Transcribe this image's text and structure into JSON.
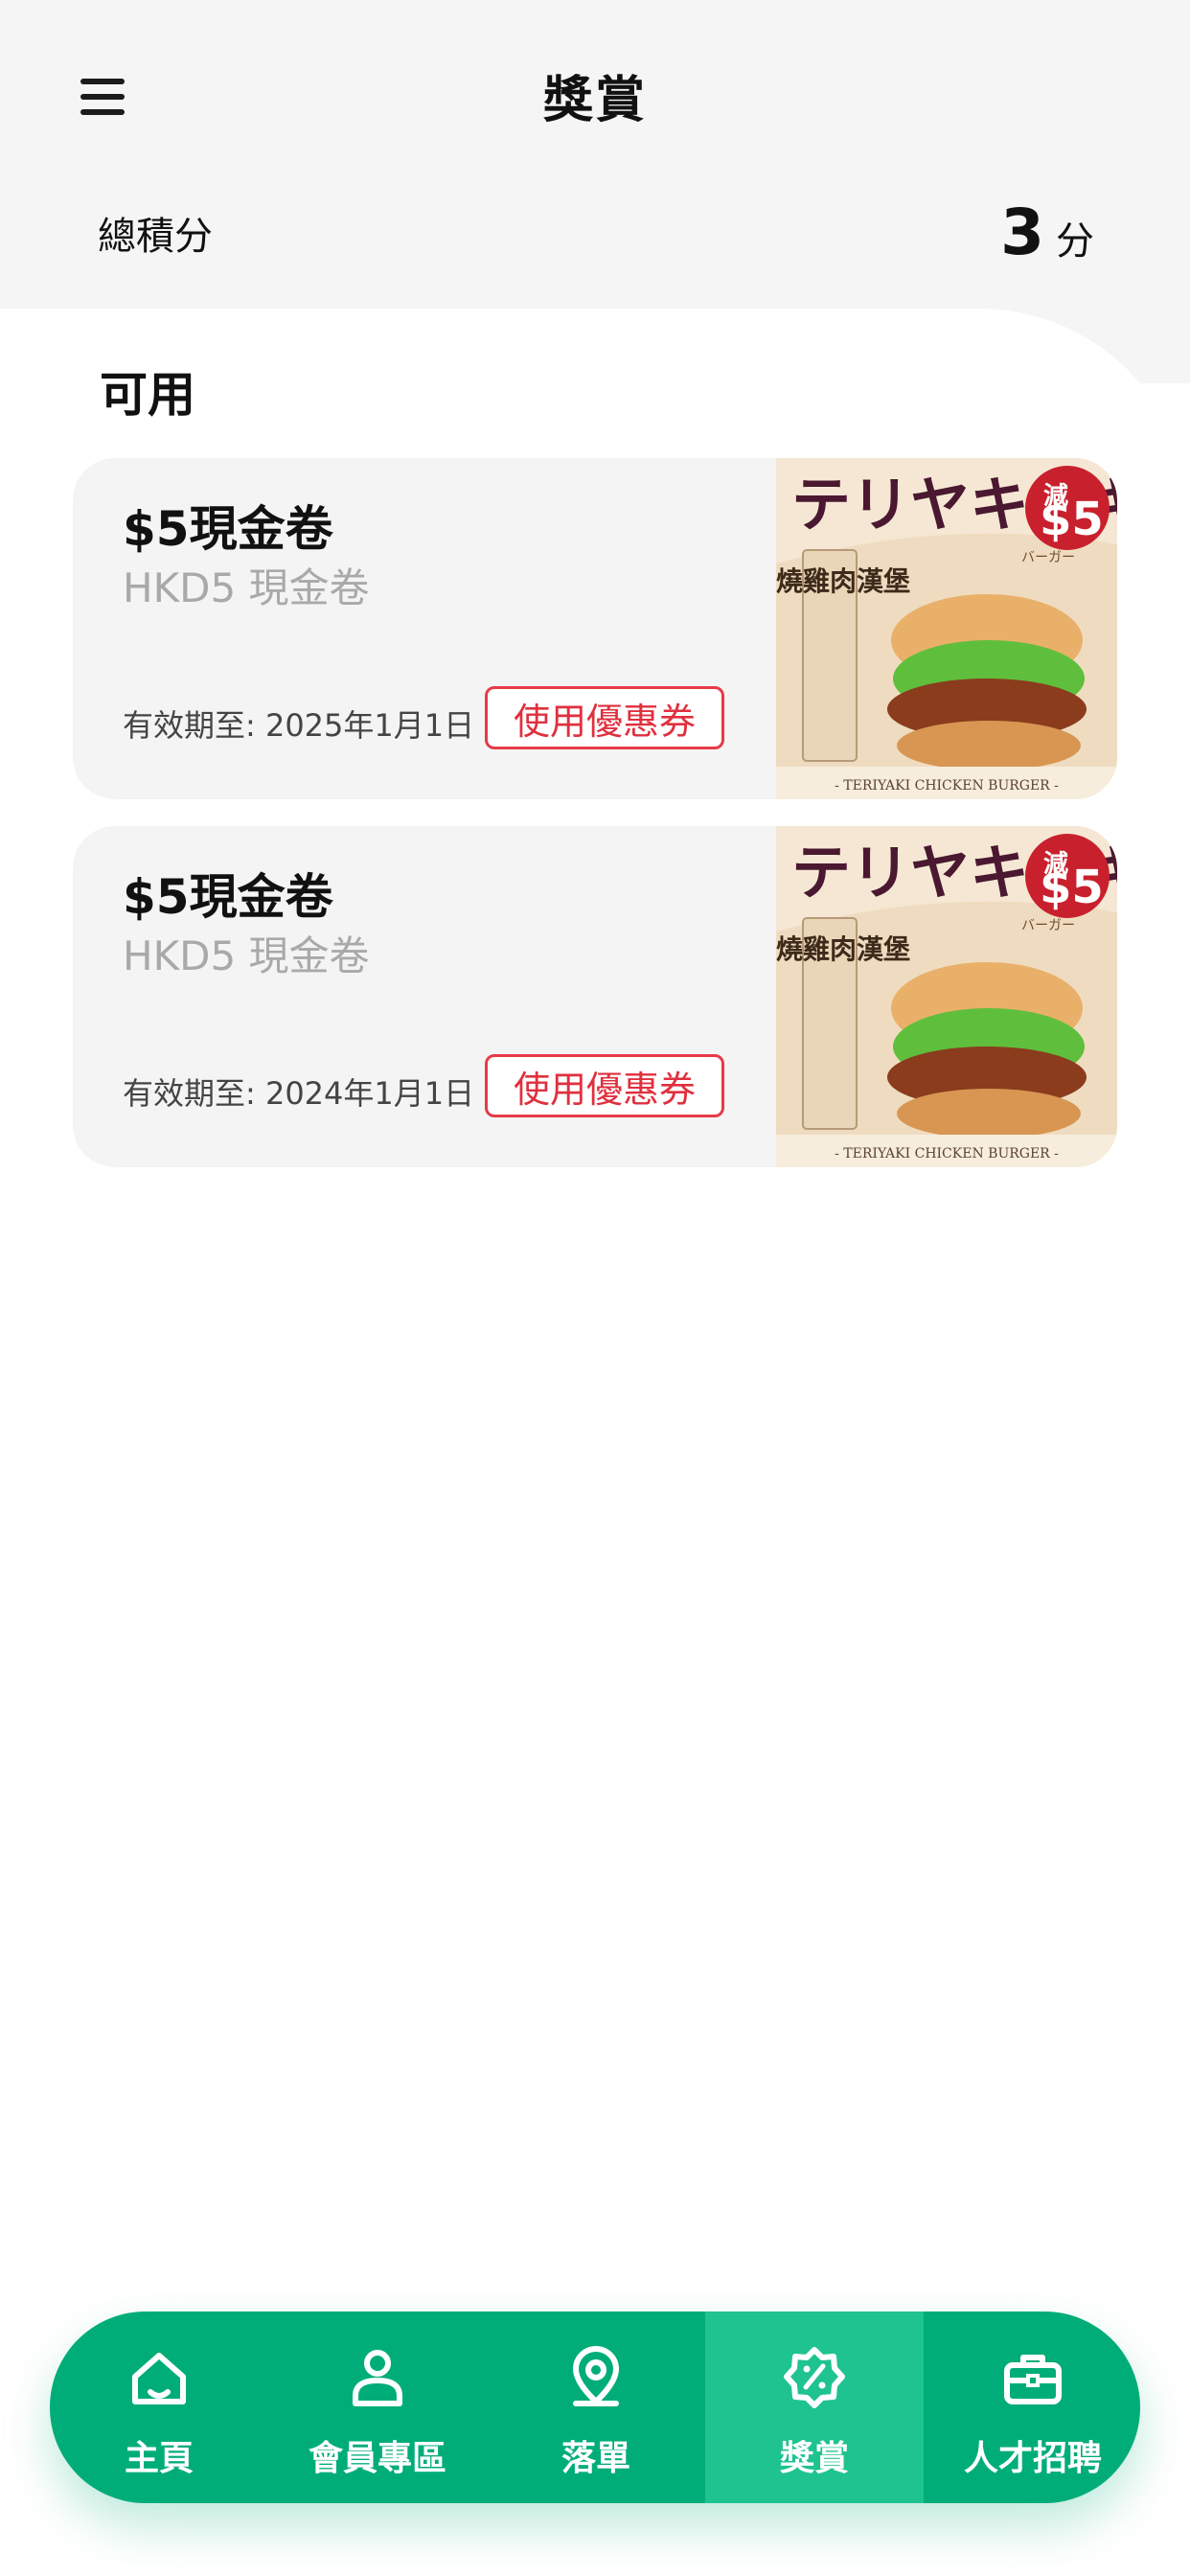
{
  "header": {
    "title": "獎賞",
    "menu_icon": "menu-icon"
  },
  "points": {
    "label": "總積分",
    "value": "3",
    "unit": "分"
  },
  "section": {
    "title": "可用"
  },
  "coupons": [
    {
      "title": "$5現金卷",
      "subtitle": "HKD5 現金卷",
      "expiry": "有效期至: 2025年1月1日",
      "button": "使用優惠券",
      "image": {
        "headline": "テリヤキチキン",
        "side_text": "照燒雞肉漢堡",
        "badge_prefix": "減",
        "badge_value": "$5",
        "footer": "- TERIYAKI CHICKEN BURGER -",
        "small": "バーガー"
      }
    },
    {
      "title": "$5現金卷",
      "subtitle": "HKD5 現金卷",
      "expiry": "有效期至: 2024年1月1日",
      "button": "使用優惠券",
      "image": {
        "headline": "テリヤキチキン",
        "side_text": "照燒雞肉漢堡",
        "badge_prefix": "減",
        "badge_value": "$5",
        "footer": "- TERIYAKI CHICKEN BURGER -",
        "small": "バーガー"
      }
    }
  ],
  "nav": {
    "items": [
      {
        "label": "主頁",
        "icon": "home-icon"
      },
      {
        "label": "會員專區",
        "icon": "member-icon"
      },
      {
        "label": "落單",
        "icon": "location-pin-icon"
      },
      {
        "label": "獎賞",
        "icon": "reward-badge-icon"
      },
      {
        "label": "人才招聘",
        "icon": "briefcase-icon"
      }
    ],
    "active": "獎賞"
  },
  "colors": {
    "brand_green": "#00ad78",
    "active_green": "#1fc38f",
    "coupon_red": "#e0303f"
  }
}
